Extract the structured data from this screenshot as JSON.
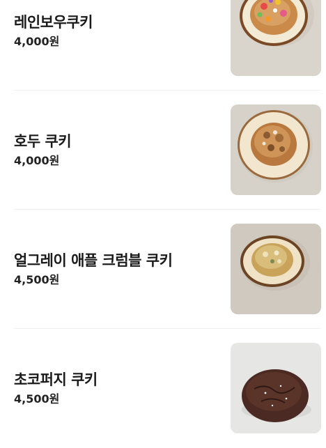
{
  "menu": {
    "items": [
      {
        "name": "레인보우쿠키",
        "price": "4,000원",
        "image": "rainbow-cookie-photo",
        "colors": {
          "bg": "#d9d4cc",
          "plate": "#f3ead6",
          "plate_rim": "#7a4a26",
          "cookie": "#c98a4a"
        }
      },
      {
        "name": "호두 쿠키",
        "price": "4,000원",
        "image": "walnut-cookie-photo",
        "colors": {
          "bg": "#d6d2c9",
          "plate": "#f2e6cf",
          "plate_rim": "#9a6a3e",
          "cookie": "#b9783e"
        }
      },
      {
        "name": "얼그레이 애플 크럼블 쿠키",
        "price": "4,500원",
        "image": "earl-grey-apple-crumble-cookie-photo",
        "colors": {
          "bg": "#cfc9bf",
          "plate": "#efe2c7",
          "plate_rim": "#6b4423",
          "cookie": "#c9a35a"
        }
      },
      {
        "name": "초코퍼지 쿠키",
        "price": "4,500원",
        "image": "chocolate-fudge-cookie-photo",
        "colors": {
          "bg": "#e6e6e4",
          "cookie": "#4a2a22"
        }
      }
    ]
  }
}
